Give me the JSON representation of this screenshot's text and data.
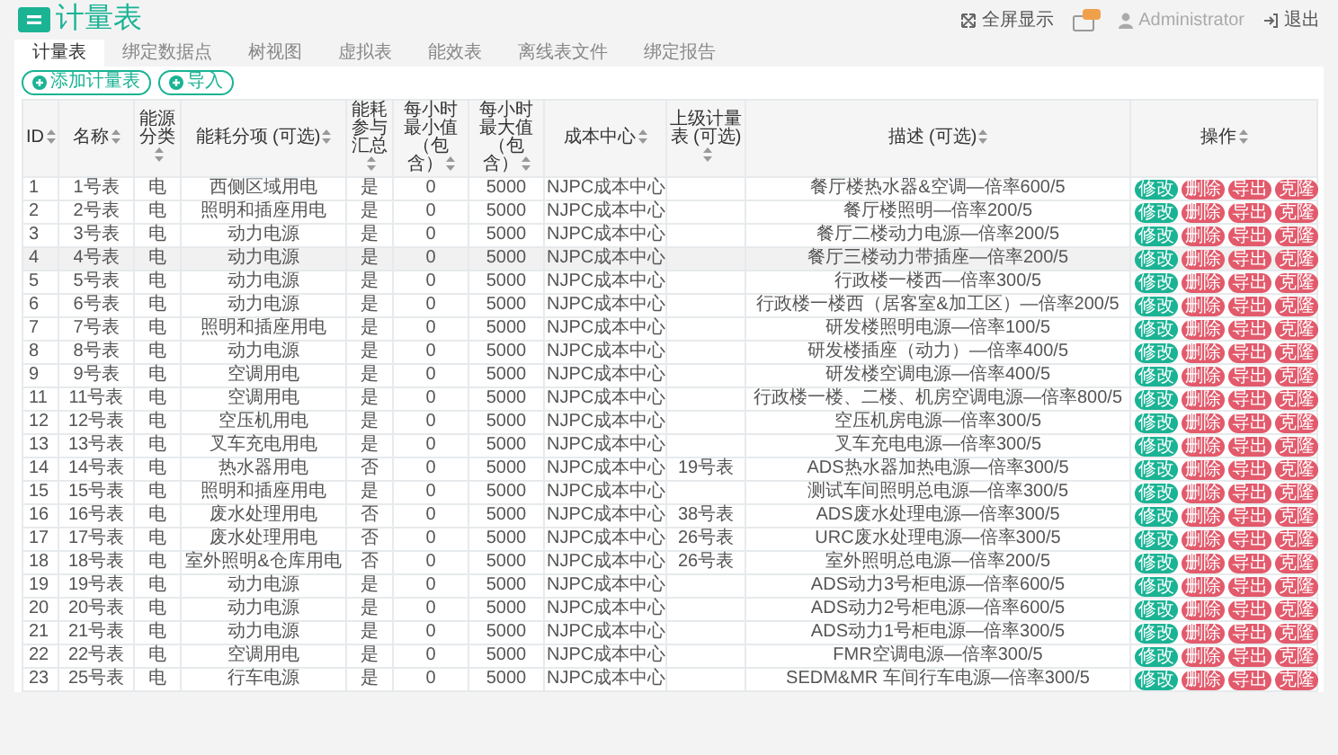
{
  "header": {
    "title": "计量表",
    "fullscreen": "全屏显示",
    "user": "Administrator",
    "logout": "退出"
  },
  "tabs": [
    {
      "label": "计量表",
      "selected": true
    },
    {
      "label": "绑定数据点",
      "selected": false
    },
    {
      "label": "树视图",
      "selected": false
    },
    {
      "label": "虚拟表",
      "selected": false
    },
    {
      "label": "能效表",
      "selected": false
    },
    {
      "label": "离线表文件",
      "selected": false
    },
    {
      "label": "绑定报告",
      "selected": false
    }
  ],
  "toolbar": [
    "添加计量表",
    "导入"
  ],
  "table": {
    "columns": [
      "ID",
      "名称",
      "能源分类",
      "能耗分项 (可选)",
      "能耗参与汇总",
      "每小时最小值（包含）",
      "每小时最大值（包含）",
      "成本中心",
      "上级计量表 (可选)",
      "描述 (可选)",
      "操作"
    ],
    "rows": [
      {
        "id": "1",
        "name": "1号表",
        "energy": "电",
        "item": "西侧区域用电",
        "summary": "是",
        "min": "0",
        "max": "5000",
        "cost_center": "NJPC成本中心",
        "description": "餐厅楼热水器&空调—倍率600/5",
        "highlighted": false,
        "actions": [
          {
            "label": "修改",
            "kind": "primary"
          },
          {
            "label": "删除",
            "kind": "danger"
          },
          {
            "label": "导出",
            "kind": "danger"
          },
          {
            "label": "克隆",
            "kind": "danger"
          }
        ]
      },
      {
        "id": "2",
        "name": "2号表",
        "energy": "电",
        "item": "照明和插座用电",
        "summary": "是",
        "min": "0",
        "max": "5000",
        "cost_center": "NJPC成本中心",
        "description": "餐厅楼照明—倍率200/5",
        "highlighted": false,
        "actions": [
          {
            "label": "修改",
            "kind": "primary"
          },
          {
            "label": "删除",
            "kind": "danger"
          },
          {
            "label": "导出",
            "kind": "danger"
          },
          {
            "label": "克隆",
            "kind": "danger"
          }
        ]
      },
      {
        "id": "3",
        "name": "3号表",
        "energy": "电",
        "item": "动力电源",
        "summary": "是",
        "min": "0",
        "max": "5000",
        "cost_center": "NJPC成本中心",
        "description": "餐厅二楼动力电源—倍率200/5",
        "highlighted": false,
        "actions": [
          {
            "label": "修改",
            "kind": "primary"
          },
          {
            "label": "删除",
            "kind": "danger"
          },
          {
            "label": "导出",
            "kind": "danger"
          },
          {
            "label": "克隆",
            "kind": "danger"
          }
        ]
      },
      {
        "id": "4",
        "name": "4号表",
        "energy": "电",
        "item": "动力电源",
        "summary": "是",
        "min": "0",
        "max": "5000",
        "cost_center": "NJPC成本中心",
        "description": "餐厅三楼动力带插座—倍率200/5",
        "highlighted": true,
        "actions": [
          {
            "label": "修改",
            "kind": "primary"
          },
          {
            "label": "删除",
            "kind": "danger"
          },
          {
            "label": "导出",
            "kind": "danger"
          },
          {
            "label": "克隆",
            "kind": "danger"
          }
        ]
      },
      {
        "id": "5",
        "name": "5号表",
        "energy": "电",
        "item": "动力电源",
        "summary": "是",
        "min": "0",
        "max": "5000",
        "cost_center": "NJPC成本中心",
        "description": "行政楼一楼西—倍率300/5",
        "highlighted": false,
        "actions": [
          {
            "label": "修改",
            "kind": "primary"
          },
          {
            "label": "删除",
            "kind": "danger"
          },
          {
            "label": "导出",
            "kind": "danger"
          },
          {
            "label": "克隆",
            "kind": "danger"
          }
        ]
      },
      {
        "id": "6",
        "name": "6号表",
        "energy": "电",
        "item": "动力电源",
        "summary": "是",
        "min": "0",
        "max": "5000",
        "cost_center": "NJPC成本中心",
        "description": "行政楼一楼西（居客室&加工区）—倍率200/5",
        "highlighted": false,
        "actions": [
          {
            "label": "修改",
            "kind": "primary"
          },
          {
            "label": "删除",
            "kind": "danger"
          },
          {
            "label": "导出",
            "kind": "danger"
          },
          {
            "label": "克隆",
            "kind": "danger"
          }
        ]
      },
      {
        "id": "7",
        "name": "7号表",
        "energy": "电",
        "item": "照明和插座用电",
        "summary": "是",
        "min": "0",
        "max": "5000",
        "cost_center": "NJPC成本中心",
        "description": "研发楼照明电源—倍率100/5",
        "highlighted": false,
        "actions": [
          {
            "label": "修改",
            "kind": "primary"
          },
          {
            "label": "删除",
            "kind": "danger"
          },
          {
            "label": "导出",
            "kind": "danger"
          },
          {
            "label": "克隆",
            "kind": "danger"
          }
        ]
      },
      {
        "id": "8",
        "name": "8号表",
        "energy": "电",
        "item": "动力电源",
        "summary": "是",
        "min": "0",
        "max": "5000",
        "cost_center": "NJPC成本中心",
        "description": "研发楼插座（动力）—倍率400/5",
        "highlighted": false,
        "actions": [
          {
            "label": "修改",
            "kind": "primary"
          },
          {
            "label": "删除",
            "kind": "danger"
          },
          {
            "label": "导出",
            "kind": "danger"
          },
          {
            "label": "克隆",
            "kind": "danger"
          }
        ]
      },
      {
        "id": "9",
        "name": "9号表",
        "energy": "电",
        "item": "空调用电",
        "summary": "是",
        "min": "0",
        "max": "5000",
        "cost_center": "NJPC成本中心",
        "description": "研发楼空调电源—倍率400/5",
        "highlighted": false,
        "actions": [
          {
            "label": "修改",
            "kind": "primary"
          },
          {
            "label": "删除",
            "kind": "danger"
          },
          {
            "label": "导出",
            "kind": "danger"
          },
          {
            "label": "克隆",
            "kind": "danger"
          }
        ]
      },
      {
        "id": "11",
        "name": "11号表",
        "energy": "电",
        "item": "空调用电",
        "summary": "是",
        "min": "0",
        "max": "5000",
        "cost_center": "NJPC成本中心",
        "description": "行政楼一楼、二楼、机房空调电源—倍率800/5",
        "highlighted": false,
        "actions": [
          {
            "label": "修改",
            "kind": "primary"
          },
          {
            "label": "删除",
            "kind": "danger"
          },
          {
            "label": "导出",
            "kind": "danger"
          },
          {
            "label": "克隆",
            "kind": "danger"
          }
        ]
      },
      {
        "id": "12",
        "name": "12号表",
        "energy": "电",
        "item": "空压机用电",
        "summary": "是",
        "min": "0",
        "max": "5000",
        "cost_center": "NJPC成本中心",
        "description": "空压机房电源—倍率300/5",
        "highlighted": false,
        "actions": [
          {
            "label": "修改",
            "kind": "primary"
          },
          {
            "label": "删除",
            "kind": "danger"
          },
          {
            "label": "导出",
            "kind": "danger"
          },
          {
            "label": "克隆",
            "kind": "danger"
          }
        ]
      },
      {
        "id": "13",
        "name": "13号表",
        "energy": "电",
        "item": "叉车充电用电",
        "summary": "是",
        "min": "0",
        "max": "5000",
        "cost_center": "NJPC成本中心",
        "description": "叉车充电电源—倍率300/5",
        "highlighted": false,
        "actions": [
          {
            "label": "修改",
            "kind": "primary"
          },
          {
            "label": "删除",
            "kind": "danger"
          },
          {
            "label": "导出",
            "kind": "danger"
          },
          {
            "label": "克隆",
            "kind": "danger"
          }
        ]
      },
      {
        "id": "14",
        "name": "14号表",
        "energy": "电",
        "item": "热水器用电",
        "summary": "否",
        "min": "0",
        "max": "5000",
        "cost_center": "NJPC成本中心",
        "parent": "19号表",
        "description": "ADS热水器加热电源—倍率300/5",
        "highlighted": false,
        "actions": [
          {
            "label": "修改",
            "kind": "primary"
          },
          {
            "label": "删除",
            "kind": "danger"
          },
          {
            "label": "导出",
            "kind": "danger"
          },
          {
            "label": "克隆",
            "kind": "danger"
          }
        ]
      },
      {
        "id": "15",
        "name": "15号表",
        "energy": "电",
        "item": "照明和插座用电",
        "summary": "是",
        "min": "0",
        "max": "5000",
        "cost_center": "NJPC成本中心",
        "description": "测试车间照明总电源—倍率300/5",
        "highlighted": false,
        "actions": [
          {
            "label": "修改",
            "kind": "primary"
          },
          {
            "label": "删除",
            "kind": "danger"
          },
          {
            "label": "导出",
            "kind": "danger"
          },
          {
            "label": "克隆",
            "kind": "danger"
          }
        ]
      },
      {
        "id": "16",
        "name": "16号表",
        "energy": "电",
        "item": "废水处理用电",
        "summary": "否",
        "min": "0",
        "max": "5000",
        "cost_center": "NJPC成本中心",
        "parent": "38号表",
        "description": "ADS废水处理电源—倍率300/5",
        "highlighted": false,
        "actions": [
          {
            "label": "修改",
            "kind": "primary"
          },
          {
            "label": "删除",
            "kind": "danger"
          },
          {
            "label": "导出",
            "kind": "danger"
          },
          {
            "label": "克隆",
            "kind": "danger"
          }
        ]
      },
      {
        "id": "17",
        "name": "17号表",
        "energy": "电",
        "item": "废水处理用电",
        "summary": "否",
        "min": "0",
        "max": "5000",
        "cost_center": "NJPC成本中心",
        "parent": "26号表",
        "description": "URC废水处理电源—倍率300/5",
        "highlighted": false,
        "actions": [
          {
            "label": "修改",
            "kind": "primary"
          },
          {
            "label": "删除",
            "kind": "danger"
          },
          {
            "label": "导出",
            "kind": "danger"
          },
          {
            "label": "克隆",
            "kind": "danger"
          }
        ]
      },
      {
        "id": "18",
        "name": "18号表",
        "energy": "电",
        "item": "室外照明&仓库用电",
        "summary": "否",
        "min": "0",
        "max": "5000",
        "cost_center": "NJPC成本中心",
        "parent": "26号表",
        "description": "室外照明总电源—倍率200/5",
        "highlighted": false,
        "actions": [
          {
            "label": "修改",
            "kind": "primary"
          },
          {
            "label": "删除",
            "kind": "danger"
          },
          {
            "label": "导出",
            "kind": "danger"
          },
          {
            "label": "克隆",
            "kind": "danger"
          }
        ]
      },
      {
        "id": "19",
        "name": "19号表",
        "energy": "电",
        "item": "动力电源",
        "summary": "是",
        "min": "0",
        "max": "5000",
        "cost_center": "NJPC成本中心",
        "description": "ADS动力3号柜电源—倍率600/5",
        "highlighted": false,
        "actions": [
          {
            "label": "修改",
            "kind": "primary"
          },
          {
            "label": "删除",
            "kind": "danger"
          },
          {
            "label": "导出",
            "kind": "danger"
          },
          {
            "label": "克隆",
            "kind": "danger"
          }
        ]
      },
      {
        "id": "20",
        "name": "20号表",
        "energy": "电",
        "item": "动力电源",
        "summary": "是",
        "min": "0",
        "max": "5000",
        "cost_center": "NJPC成本中心",
        "description": "ADS动力2号柜电源—倍率600/5",
        "highlighted": false,
        "actions": [
          {
            "label": "修改",
            "kind": "primary"
          },
          {
            "label": "删除",
            "kind": "danger"
          },
          {
            "label": "导出",
            "kind": "danger"
          },
          {
            "label": "克隆",
            "kind": "danger"
          }
        ]
      },
      {
        "id": "21",
        "name": "21号表",
        "energy": "电",
        "item": "动力电源",
        "summary": "是",
        "min": "0",
        "max": "5000",
        "cost_center": "NJPC成本中心",
        "description": "ADS动力1号柜电源—倍率300/5",
        "highlighted": false,
        "actions": [
          {
            "label": "修改",
            "kind": "primary"
          },
          {
            "label": "删除",
            "kind": "danger"
          },
          {
            "label": "导出",
            "kind": "danger"
          },
          {
            "label": "克隆",
            "kind": "danger"
          }
        ]
      },
      {
        "id": "22",
        "name": "22号表",
        "energy": "电",
        "item": "空调用电",
        "summary": "是",
        "min": "0",
        "max": "5000",
        "cost_center": "NJPC成本中心",
        "description": "FMR空调电源—倍率300/5",
        "highlighted": false,
        "actions": [
          {
            "label": "修改",
            "kind": "primary"
          },
          {
            "label": "删除",
            "kind": "danger"
          },
          {
            "label": "导出",
            "kind": "danger"
          },
          {
            "label": "克隆",
            "kind": "danger"
          }
        ]
      },
      {
        "id": "23",
        "name": "25号表",
        "energy": "电",
        "item": "行车电源",
        "summary": "是",
        "min": "0",
        "max": "5000",
        "cost_center": "NJPC成本中心",
        "description": "SEDM&MR 车间行车电源—倍率300/5",
        "highlighted": false,
        "actions": [
          {
            "label": "修改",
            "kind": "primary"
          },
          {
            "label": "删除",
            "kind": "danger"
          },
          {
            "label": "导出",
            "kind": "danger"
          },
          {
            "label": "克隆",
            "kind": "danger"
          }
        ]
      }
    ]
  }
}
